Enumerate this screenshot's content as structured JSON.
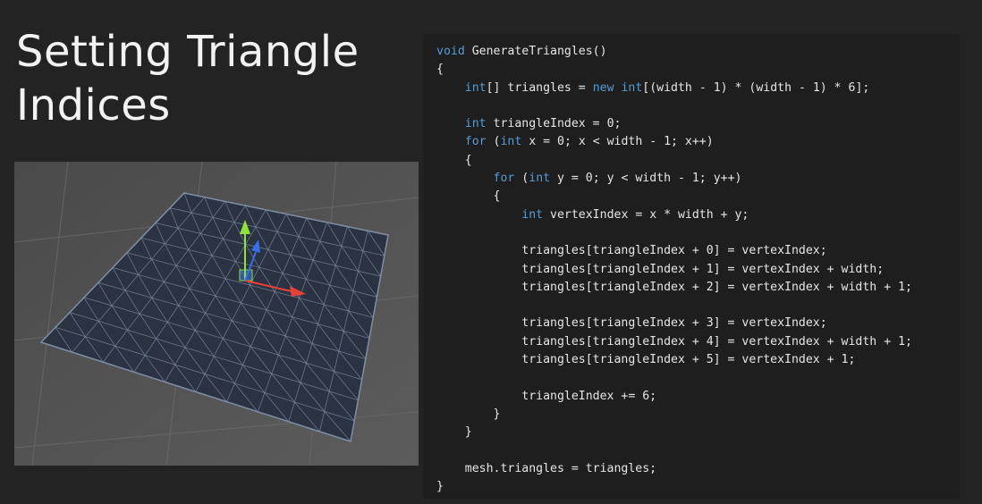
{
  "slide": {
    "title_line1": "Setting Triangle",
    "title_line2": "Indices"
  },
  "colors": {
    "background": "#232323",
    "keyword": "#569cd6",
    "code_text": "#e6e6e6",
    "mesh_fill": "#2b3342",
    "mesh_lines": "#7d8da6",
    "axis_x": "#e8413a",
    "axis_y": "#8fe03a",
    "axis_z": "#3a6ee8"
  },
  "viewport": {
    "grid_divisions": 10,
    "gizmo_icons": [
      "move-gizmo-x-arrow",
      "move-gizmo-y-arrow",
      "move-gizmo-z-arrow"
    ]
  },
  "code": {
    "lines": [
      [
        {
          "k": 1,
          "t": "void"
        },
        {
          "t": " GenerateTriangles()"
        }
      ],
      [
        {
          "t": "{"
        }
      ],
      [
        {
          "t": "    "
        },
        {
          "k": 1,
          "t": "int"
        },
        {
          "t": "[] triangles = "
        },
        {
          "k": 1,
          "t": "new"
        },
        {
          "t": " "
        },
        {
          "k": 1,
          "t": "int"
        },
        {
          "t": "[(width - 1) * (width - 1) * 6];"
        }
      ],
      [
        {
          "t": ""
        }
      ],
      [
        {
          "t": "    "
        },
        {
          "k": 1,
          "t": "int"
        },
        {
          "t": " triangleIndex = 0;"
        }
      ],
      [
        {
          "t": "    "
        },
        {
          "k": 1,
          "t": "for"
        },
        {
          "t": " ("
        },
        {
          "k": 1,
          "t": "int"
        },
        {
          "t": " x = 0; x < width - 1; x++)"
        }
      ],
      [
        {
          "t": "    {"
        }
      ],
      [
        {
          "t": "        "
        },
        {
          "k": 1,
          "t": "for"
        },
        {
          "t": " ("
        },
        {
          "k": 1,
          "t": "int"
        },
        {
          "t": " y = 0; y < width - 1; y++)"
        }
      ],
      [
        {
          "t": "        {"
        }
      ],
      [
        {
          "t": "            "
        },
        {
          "k": 1,
          "t": "int"
        },
        {
          "t": " vertexIndex = x * width + y;"
        }
      ],
      [
        {
          "t": ""
        }
      ],
      [
        {
          "t": "            triangles[triangleIndex + 0] = vertexIndex;"
        }
      ],
      [
        {
          "t": "            triangles[triangleIndex + 1] = vertexIndex + width;"
        }
      ],
      [
        {
          "t": "            triangles[triangleIndex + 2] = vertexIndex + width + 1;"
        }
      ],
      [
        {
          "t": ""
        }
      ],
      [
        {
          "t": "            triangles[triangleIndex + 3] = vertexIndex;"
        }
      ],
      [
        {
          "t": "            triangles[triangleIndex + 4] = vertexIndex + width + 1;"
        }
      ],
      [
        {
          "t": "            triangles[triangleIndex + 5] = vertexIndex + 1;"
        }
      ],
      [
        {
          "t": ""
        }
      ],
      [
        {
          "t": "            triangleIndex += 6;"
        }
      ],
      [
        {
          "t": "        }"
        }
      ],
      [
        {
          "t": "    }"
        }
      ],
      [
        {
          "t": ""
        }
      ],
      [
        {
          "t": "    mesh.triangles = triangles;"
        }
      ],
      [
        {
          "t": "}"
        }
      ]
    ]
  }
}
